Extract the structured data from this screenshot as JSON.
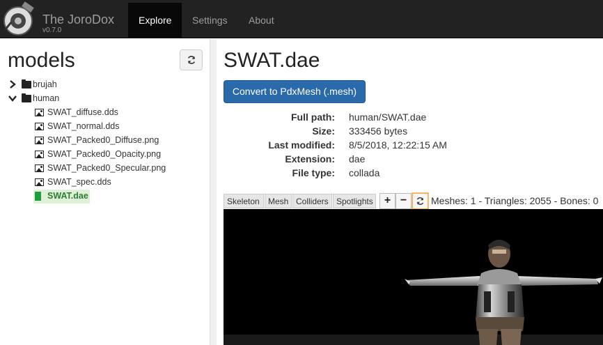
{
  "app": {
    "title": "The JoroDox",
    "version": "v0.7.0"
  },
  "nav": [
    {
      "label": "Explore",
      "active": true
    },
    {
      "label": "Settings",
      "active": false
    },
    {
      "label": "About",
      "active": false
    }
  ],
  "sidebar": {
    "title": "models",
    "refresh_icon": "refresh-icon",
    "tree": [
      {
        "label": "brujah",
        "type": "folder",
        "expanded": false
      },
      {
        "label": "human",
        "type": "folder",
        "expanded": true
      },
      {
        "label": "SWAT_diffuse.dds",
        "type": "image"
      },
      {
        "label": "SWAT_normal.dds",
        "type": "image"
      },
      {
        "label": "SWAT_Packed0_Diffuse.png",
        "type": "image"
      },
      {
        "label": "SWAT_Packed0_Opacity.png",
        "type": "image"
      },
      {
        "label": "SWAT_Packed0_Specular.png",
        "type": "image"
      },
      {
        "label": "SWAT_spec.dds",
        "type": "image"
      },
      {
        "label": "SWAT.dae",
        "type": "file",
        "selected": true
      }
    ]
  },
  "main": {
    "file_title": "SWAT.dae",
    "convert_label": "Convert to PdxMesh (.mesh)",
    "info": [
      {
        "key": "Full path:",
        "value": "human/SWAT.dae"
      },
      {
        "key": "Size:",
        "value": "333456 bytes"
      },
      {
        "key": "Last modified:",
        "value": "8/5/2018, 12:22:15 AM"
      },
      {
        "key": "Extension:",
        "value": "dae"
      },
      {
        "key": "File type:",
        "value": "collada"
      }
    ],
    "viewer": {
      "tabs": [
        "Skeleton",
        "Mesh",
        "Colliders",
        "Spotlights"
      ],
      "zoom_in": "+",
      "zoom_out": "−",
      "reset_icon": "refresh-icon",
      "stats": "Meshes: 1 - Triangles: 2055 - Bones: 0"
    }
  },
  "colors": {
    "navbar": "#222222",
    "accent": "#2a6aaa",
    "selected": "#dff0d8"
  }
}
